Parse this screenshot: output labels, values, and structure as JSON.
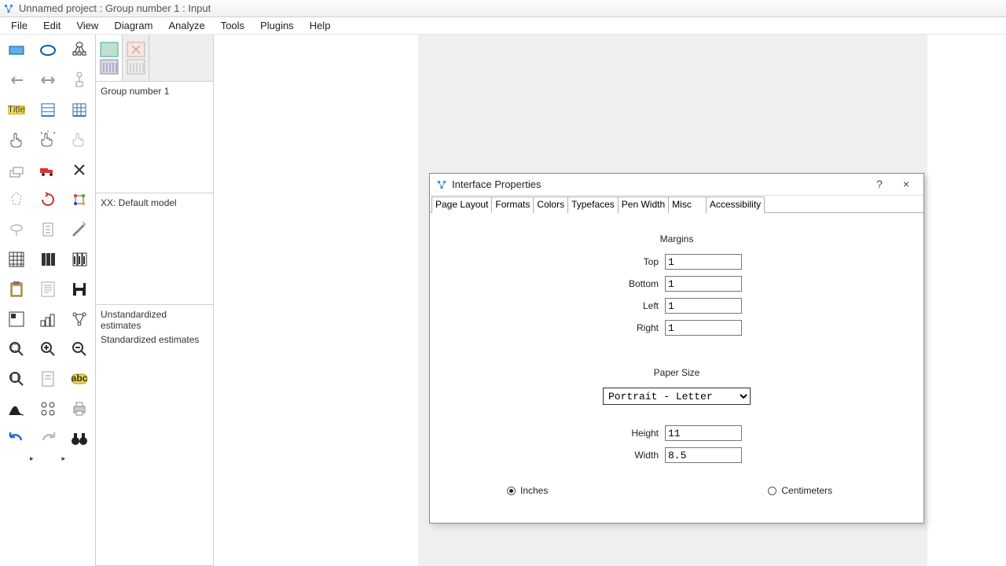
{
  "titlebar": {
    "text": "Unnamed project : Group number 1 : Input"
  },
  "menu": {
    "items": [
      "File",
      "Edit",
      "View",
      "Diagram",
      "Analyze",
      "Tools",
      "Plugins",
      "Help"
    ]
  },
  "side_panel": {
    "group_label": "Group number 1",
    "model_label": "XX: Default model",
    "est_unstd": "Unstandardized estimates",
    "est_std": "Standardized estimates"
  },
  "dialog": {
    "title": "Interface Properties",
    "help": "?",
    "close": "×",
    "tabs": [
      "Page Layout",
      "Formats",
      "Colors",
      "Typefaces",
      "Pen Width",
      "Misc",
      "",
      "Accessibility"
    ],
    "active_tab": 0,
    "margins": {
      "title": "Margins",
      "top_label": "Top",
      "top_val": "1",
      "bottom_label": "Bottom",
      "bottom_val": "1",
      "left_label": "Left",
      "left_val": "1",
      "right_label": "Right",
      "right_val": "1"
    },
    "paper": {
      "title": "Paper Size",
      "select": "Portrait - Letter",
      "height_label": "Height",
      "height_val": "11",
      "width_label": "Width",
      "width_val": "8.5"
    },
    "units": {
      "inches": "Inches",
      "cm": "Centimeters",
      "selected": "inches"
    }
  }
}
